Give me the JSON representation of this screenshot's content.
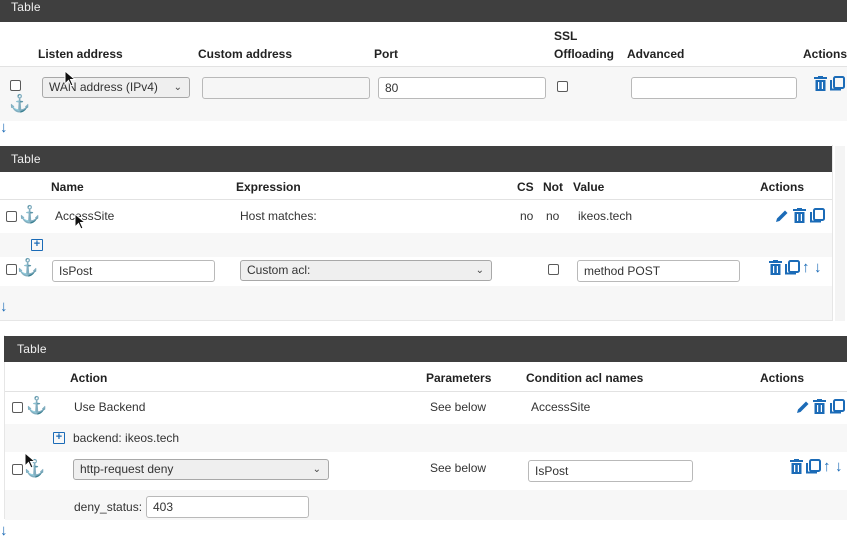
{
  "table1": {
    "title": "Table",
    "headers": {
      "listen": "Listen address",
      "custom": "Custom address",
      "port": "Port",
      "ssl_line1": "SSL",
      "ssl_line2": "Offloading",
      "advanced": "Advanced",
      "actions": "Actions"
    },
    "row": {
      "listen_value": "WAN address (IPv4)",
      "custom_value": "",
      "port_value": "80",
      "advanced_value": ""
    }
  },
  "table2": {
    "title": "Table",
    "headers": {
      "name": "Name",
      "expression": "Expression",
      "cs": "CS",
      "not": "Not",
      "value": "Value",
      "actions": "Actions"
    },
    "row1": {
      "name": "AccessSite",
      "expression": "Host matches:",
      "cs": "no",
      "not": "no",
      "value": "ikeos.tech"
    },
    "row2": {
      "name": "IsPost",
      "expression": "Custom acl:",
      "value": "method POST"
    }
  },
  "table3": {
    "title": "Table",
    "headers": {
      "action": "Action",
      "parameters": "Parameters",
      "condition": "Condition acl names",
      "actions": "Actions"
    },
    "row1": {
      "action": "Use Backend",
      "parameters": "See below",
      "condition": "AccessSite",
      "detail": "backend: ikeos.tech"
    },
    "row2": {
      "action": "http-request deny",
      "parameters": "See below",
      "condition": "IsPost",
      "deny_label": "deny_status:",
      "deny_value": "403"
    }
  },
  "colors": {
    "title_bar": "#3f3f3f",
    "accent": "#1b6bb7",
    "row_alt": "#f7f7f7"
  },
  "icons": [
    "anchor-icon",
    "trash-icon",
    "copy-icon",
    "pencil-icon",
    "arrow-up-icon",
    "arrow-down-icon",
    "expand-plus-icon",
    "chevron-down-icon"
  ]
}
